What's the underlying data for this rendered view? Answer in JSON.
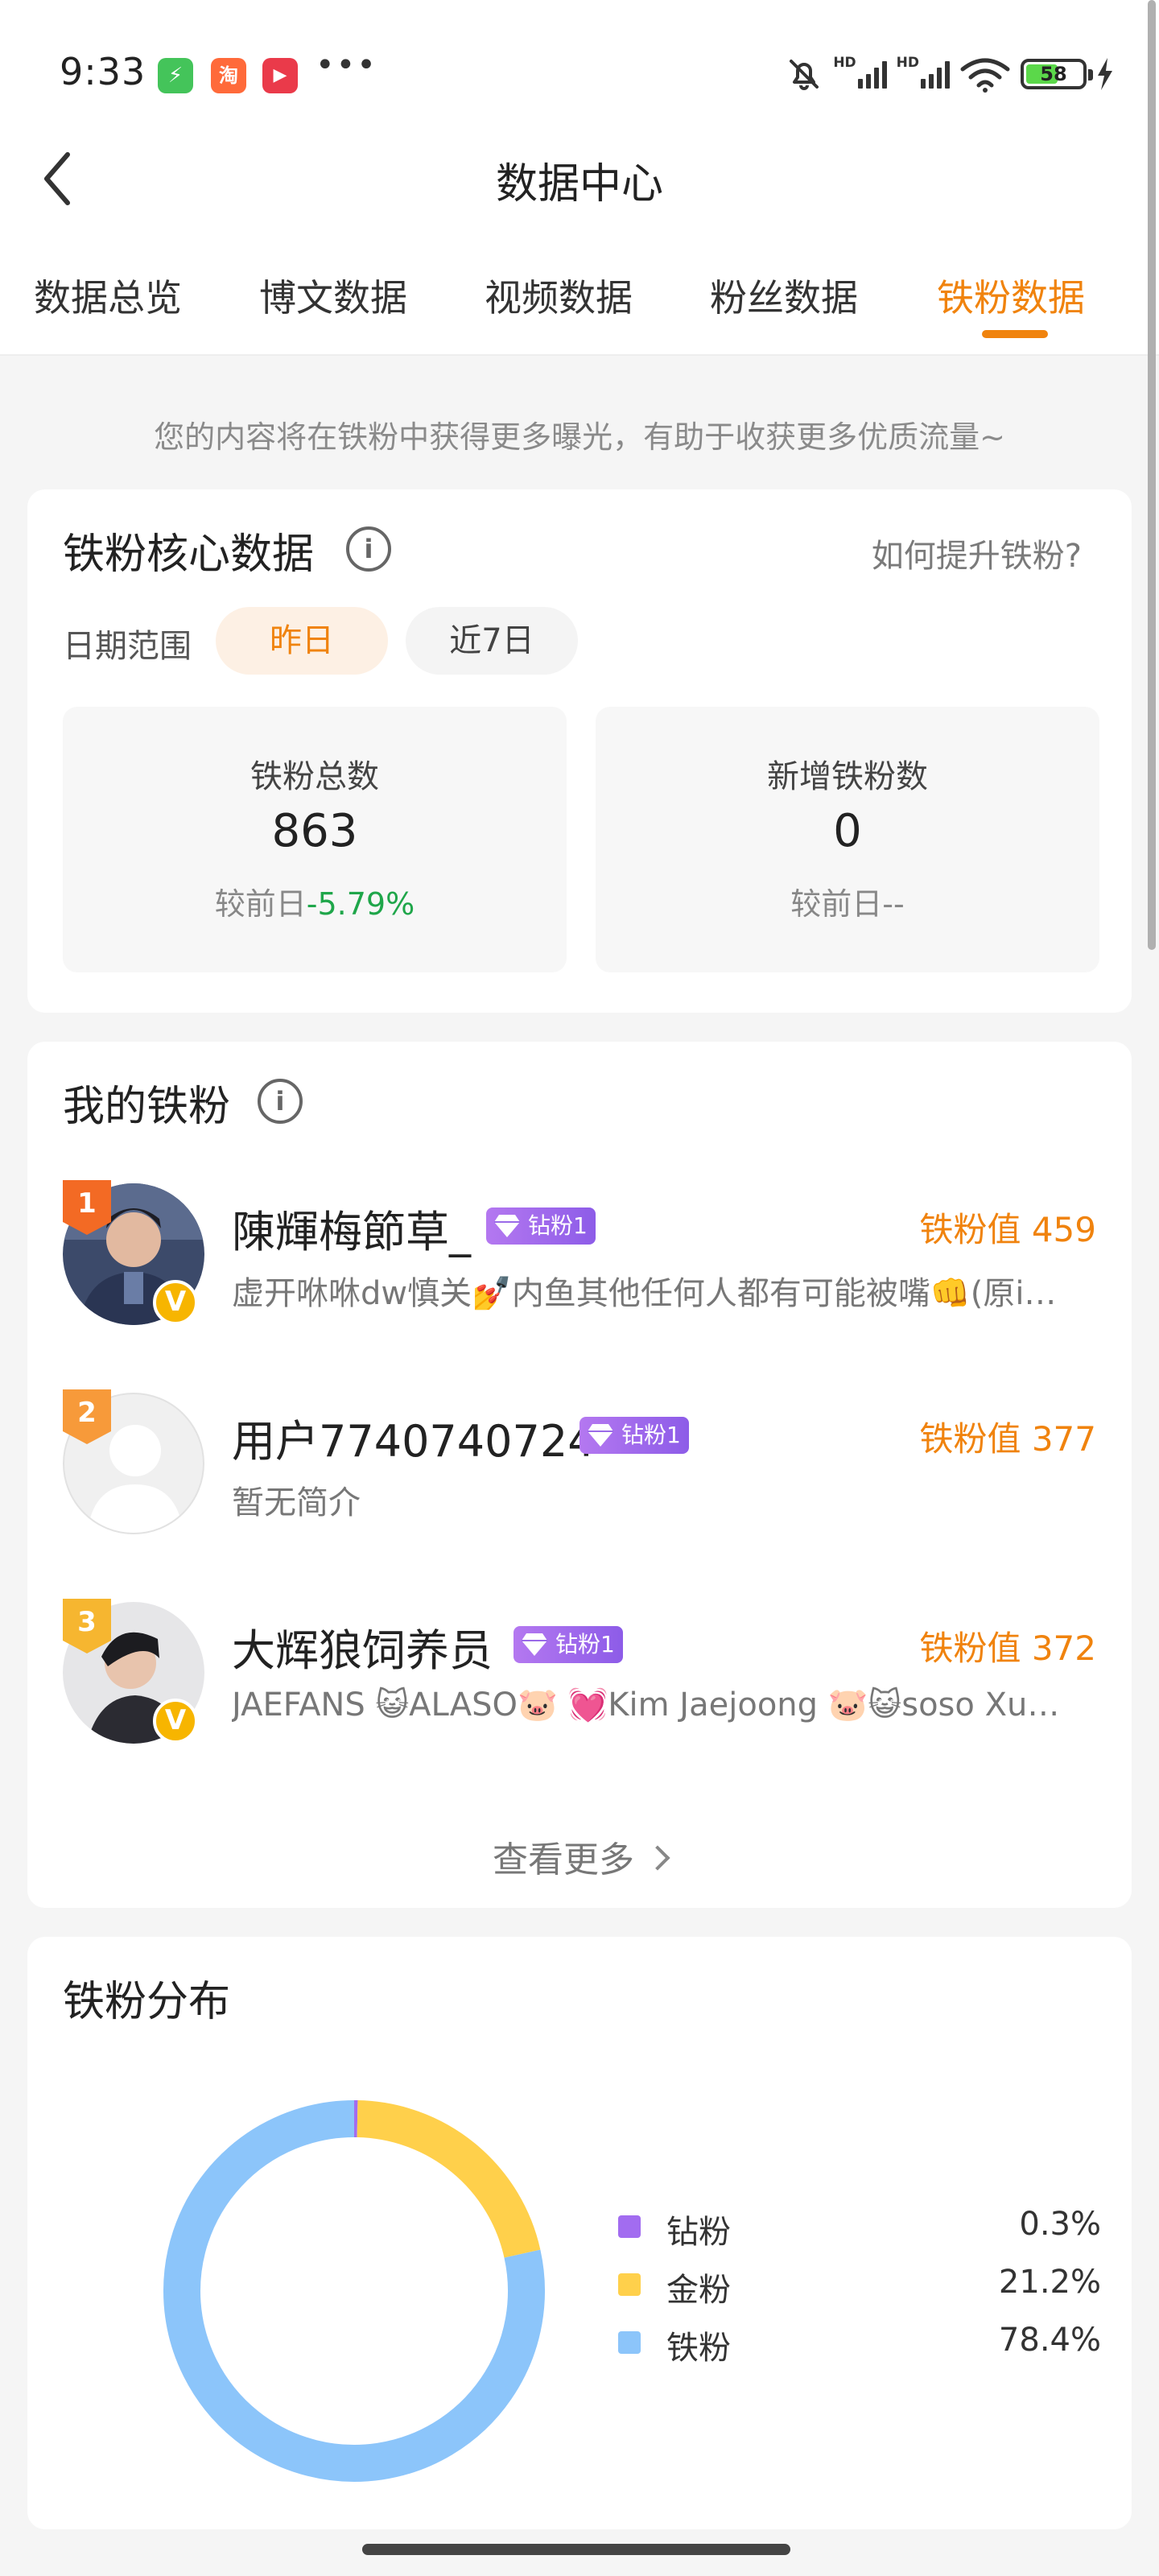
{
  "status_bar": {
    "time": "9:33",
    "app_icons": [
      {
        "name": "charge-app-icon",
        "glyph": "⚡",
        "color": "#44c45a"
      },
      {
        "name": "taobao-app-icon",
        "glyph": "淘",
        "color": "#ff6a3a"
      },
      {
        "name": "video-app-icon",
        "glyph": "▶",
        "color": "#ea3a4a"
      }
    ],
    "more": "•••",
    "hd1": "HD",
    "hd2": "HD",
    "battery": "58"
  },
  "nav": {
    "title": "数据中心"
  },
  "tabs": [
    {
      "label": "数据总览",
      "active": false
    },
    {
      "label": "博文数据",
      "active": false
    },
    {
      "label": "视频数据",
      "active": false
    },
    {
      "label": "粉丝数据",
      "active": false
    },
    {
      "label": "铁粉数据",
      "active": true
    }
  ],
  "tip": "您的内容将在铁粉中获得更多曝光，有助于收获更多优质流量~",
  "core": {
    "title": "铁粉核心数据",
    "info": "i",
    "link": "如何提升铁粉?",
    "date_label": "日期范围",
    "range_options": [
      "昨日",
      "近7日"
    ],
    "selected_range": "昨日",
    "stats": [
      {
        "label": "铁粉总数",
        "value": "863",
        "compare_label": "较前日",
        "compare_value": "-5.79%"
      },
      {
        "label": "新增铁粉数",
        "value": "0",
        "compare_label": "较前日",
        "compare_value": "--"
      }
    ]
  },
  "my_fans": {
    "title": "我的铁粉",
    "info": "i",
    "items": [
      {
        "rank": "1",
        "name": "陳輝梅節草_",
        "badge": "钻粉1",
        "score": "铁粉值 459",
        "desc": "虚开咻咻dw慎关💅内鱼其他任何人都有可能被嘴👊(原i…",
        "verified": "V"
      },
      {
        "rank": "2",
        "name": "用户7740740724",
        "badge": "钻粉1",
        "score": "铁粉值 377",
        "desc": "暂无简介",
        "verified": ""
      },
      {
        "rank": "3",
        "name": "大辉狼饲养员",
        "badge": "钻粉1",
        "score": "铁粉值 372",
        "desc": "JAEFANS 😺ALASO🐷 💓Kim Jaejoong 🐷😺soso Xu…",
        "verified": "V"
      }
    ],
    "more": "查看更多"
  },
  "distribution": {
    "title": "铁粉分布",
    "colors": {
      "diamond": "#a26cf0",
      "gold": "#ffd04b",
      "iron": "#8cc5fa"
    }
  },
  "chart_data": {
    "type": "pie",
    "donut": true,
    "categories": [
      "钻粉",
      "金粉",
      "铁粉"
    ],
    "values": [
      0.3,
      21.2,
      78.4
    ],
    "labels": [
      "0.3%",
      "21.2%",
      "78.4%"
    ],
    "colors": [
      "#a26cf0",
      "#ffd04b",
      "#8cc5fa"
    ],
    "legend": "right"
  }
}
